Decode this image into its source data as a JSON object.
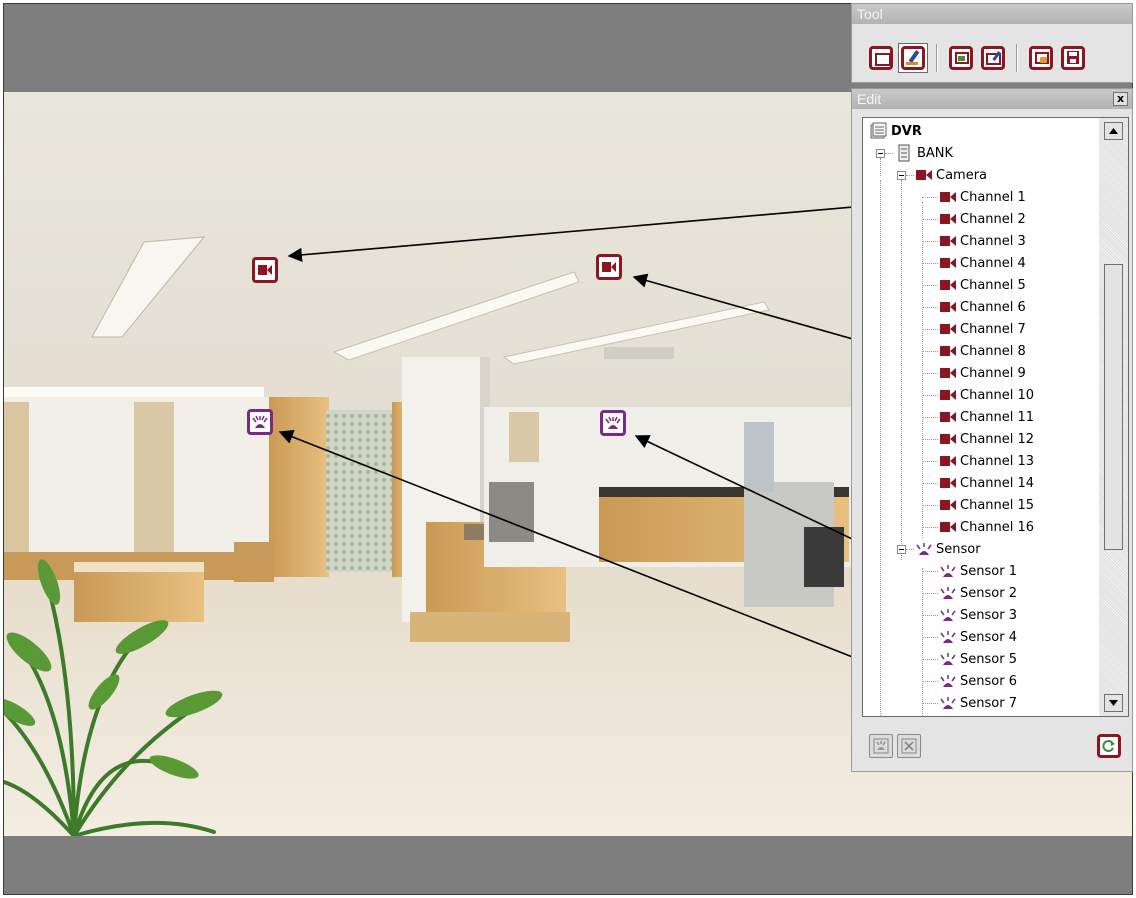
{
  "colors": {
    "camera_accent": "#8a1622",
    "sensor_accent": "#7a2a86",
    "background_gray": "#7e7e7e"
  },
  "tool_panel": {
    "title": "Tool",
    "buttons": [
      {
        "name": "window-icon",
        "active": false
      },
      {
        "name": "edit-pencil-icon",
        "active": true
      },
      {
        "name": "image-icon",
        "active": false
      },
      {
        "name": "rename-icon",
        "active": false
      },
      {
        "name": "lock-image-icon",
        "active": false
      },
      {
        "name": "save-icon",
        "active": false
      }
    ]
  },
  "edit_panel": {
    "title": "Edit",
    "close_label": "x",
    "tree": {
      "root": "DVR",
      "site": "BANK",
      "camera_group": "Camera",
      "channels": [
        "Channel 1",
        "Channel 2",
        "Channel 3",
        "Channel 4",
        "Channel 5",
        "Channel 6",
        "Channel 7",
        "Channel 8",
        "Channel 9",
        "Channel 10",
        "Channel 11",
        "Channel 12",
        "Channel 13",
        "Channel 14",
        "Channel 15",
        "Channel 16"
      ],
      "sensor_group": "Sensor",
      "sensors": [
        "Sensor 1",
        "Sensor 2",
        "Sensor 3",
        "Sensor 4",
        "Sensor 5",
        "Sensor 6",
        "Sensor 7"
      ]
    },
    "bottom_buttons": [
      "sensor-edit-icon",
      "delete-icon",
      "refresh-icon"
    ]
  },
  "map_markers": [
    {
      "type": "camera",
      "linked_item": "Channel 1"
    },
    {
      "type": "camera",
      "linked_item": "Channel 8"
    },
    {
      "type": "sensor",
      "linked_item": "Sensor 6"
    },
    {
      "type": "sensor",
      "linked_item": "Sensor 1"
    }
  ]
}
